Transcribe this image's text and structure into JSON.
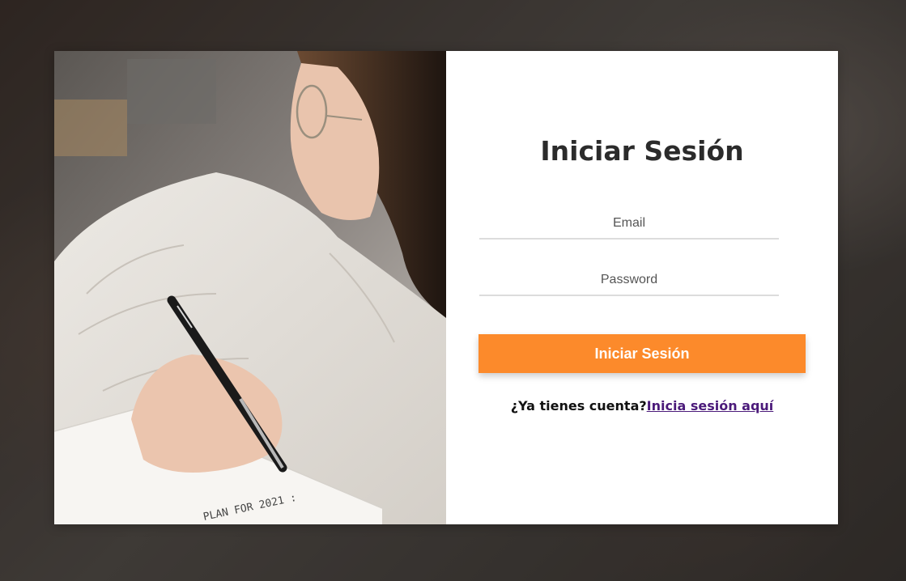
{
  "form": {
    "title": "Iniciar Sesión",
    "email_placeholder": "Email",
    "password_placeholder": "Password",
    "submit_label": "Iniciar Sesión",
    "footer_prompt": "¿Ya tienes cuenta?",
    "footer_link": "Inicia sesión aquí"
  },
  "photo": {
    "notebook_text": "PLAN FOR 2021 :"
  },
  "colors": {
    "accent": "#fc8a2b",
    "link": "#4b1a7a",
    "title": "#2b2b2b",
    "field_underline": "#dcdcdc"
  }
}
